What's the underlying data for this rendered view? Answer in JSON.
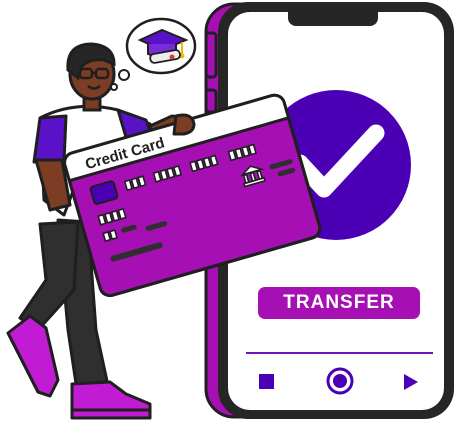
{
  "card": {
    "title": "Credit Card"
  },
  "phone": {
    "action_label": "TRANSFER",
    "status_icon": "checkmark-icon",
    "controls": [
      "stop-icon",
      "record-icon",
      "play-icon"
    ]
  },
  "thought": {
    "icon": "graduation-cap-icon"
  },
  "colors": {
    "brand_purple": "#A50FB4",
    "check_purple": "#4C00B6",
    "outline": "#1F1F1F",
    "skin": "#7B3E24"
  }
}
